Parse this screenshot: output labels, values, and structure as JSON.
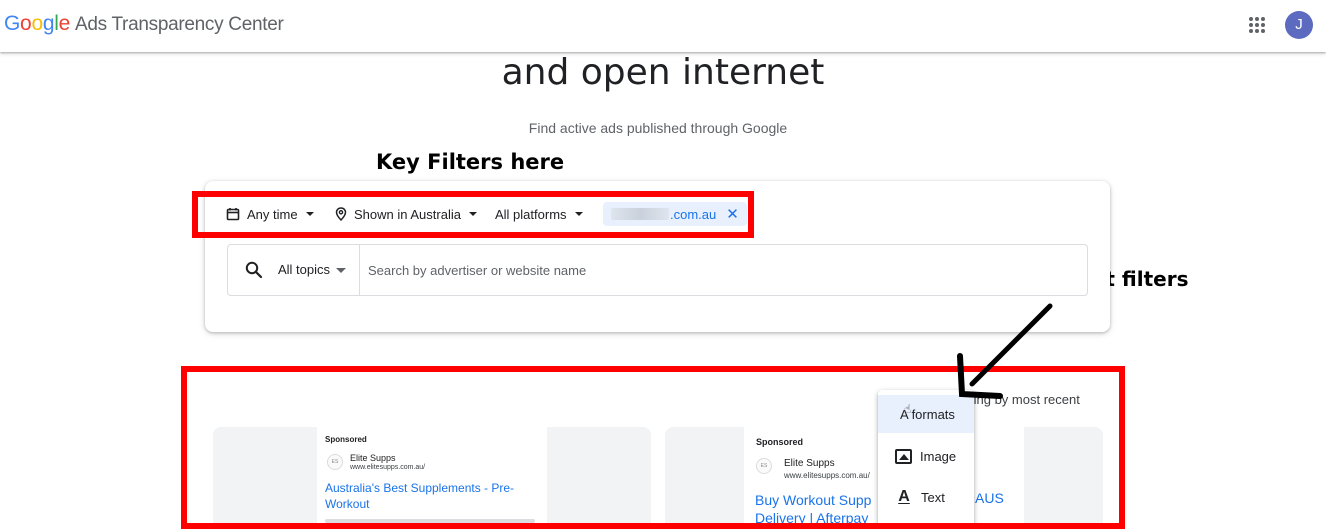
{
  "header": {
    "logo_google": [
      "G",
      "o",
      "o",
      "g",
      "l",
      "e"
    ],
    "product_name": "Ads Transparency Center",
    "avatar_initial": "J",
    "colors": {
      "google_blue": "#4285f4",
      "google_red": "#ea4335",
      "google_yellow": "#fbbc05",
      "google_green": "#34a853",
      "avatar": "#5c6bc0"
    }
  },
  "hero": {
    "title": "and open internet",
    "subtitle": "Find active ads published through Google"
  },
  "annotations": {
    "filters_label": "Key Filters here",
    "formats_label": "Ads with format filters",
    "highlight_color": "#ff0000"
  },
  "filters": {
    "time": "Any time",
    "location": "Shown in Australia",
    "platform": "All platforms",
    "domain_suffix": ".com.au"
  },
  "search": {
    "topics": "All topics",
    "placeholder": "Search by advertiser or website name"
  },
  "results": {
    "sort_label": "ting by most recent",
    "format_menu": {
      "items": [
        "All formats",
        "Image",
        "Text"
      ],
      "selected": "All formats",
      "selected_visible_text": "A formats"
    },
    "ads": [
      {
        "sponsored": "Sponsored",
        "advertiser": "Elite Supps",
        "url": "www.elitesupps.com.au/",
        "headline": "Australia's Best Supplements - Pre-Workout"
      },
      {
        "sponsored": "Sponsored",
        "advertiser": "Elite Supps",
        "url": "www.elitesupps.com.au/",
        "headline_line1": "Buy Workout Supp",
        "headline_line2": "Delivery | Afterpay",
        "headline_tail": "AUS"
      }
    ]
  }
}
